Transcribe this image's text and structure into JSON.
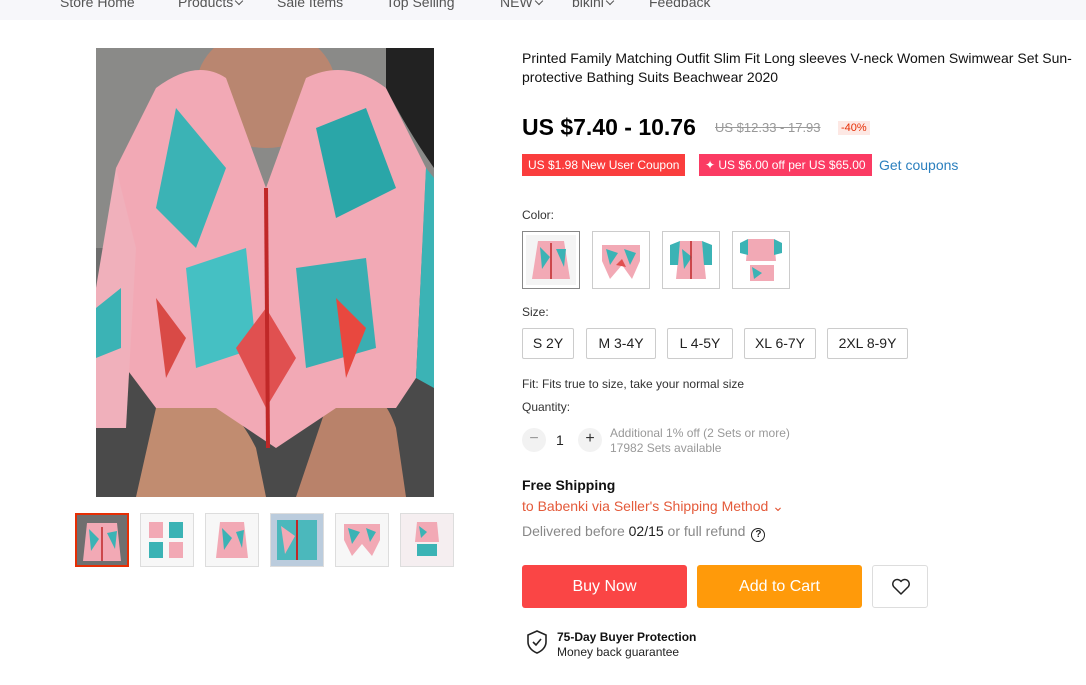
{
  "nav": {
    "items": [
      "Store Home",
      "Products",
      "Sale Items",
      "Top Selling",
      "NEW",
      "bikini",
      "Feedback"
    ],
    "with_dropdown": [
      false,
      true,
      false,
      false,
      true,
      true,
      false
    ]
  },
  "product": {
    "title": "Printed Family Matching Outfit Slim Fit Long sleeves V-neck Women Swimwear Set Sun-protective Bathing Suits Beachwear 2020",
    "price": "US $7.40 - 10.76",
    "old_price": "US $12.33 - 17.93",
    "discount": "-40%",
    "coupon_new_user": "US $1.98 New User Coupon",
    "coupon_store": "✦ US $6.00 off per US $65.00",
    "get_coupons": "Get coupons"
  },
  "options": {
    "color_label": "Color:",
    "colors": [
      "women-swimsuit",
      "boys-shorts",
      "girls-swimsuit",
      "baby-set"
    ],
    "size_label": "Size:",
    "sizes": [
      "S 2Y",
      "M 3-4Y",
      "L 4-5Y",
      "XL 6-7Y",
      "2XL 8-9Y"
    ],
    "fit": "Fit: Fits true to size, take your normal size",
    "quantity_label": "Quantity:",
    "quantity": "1",
    "qty_minus": "−",
    "qty_plus": "+",
    "qty_discount": "Additional 1% off (2 Sets or more)",
    "qty_available": "17982 Sets available"
  },
  "shipping": {
    "title": "Free Shipping",
    "destination": "to Babenki via Seller's Shipping Method ⌄",
    "delivery_prefix": "Delivered before ",
    "delivery_date": "02/15",
    "delivery_suffix": " or full refund",
    "help": "?"
  },
  "actions": {
    "buy_now": "Buy Now",
    "add_to_cart": "Add to Cart"
  },
  "protection": {
    "title": "75-Day Buyer Protection",
    "subtitle": "Money back guarantee"
  },
  "colors": {
    "buy": "#fa4545",
    "cart": "#ff9a0a",
    "link": "#2a7fbe",
    "price_red": "#e62e04"
  }
}
